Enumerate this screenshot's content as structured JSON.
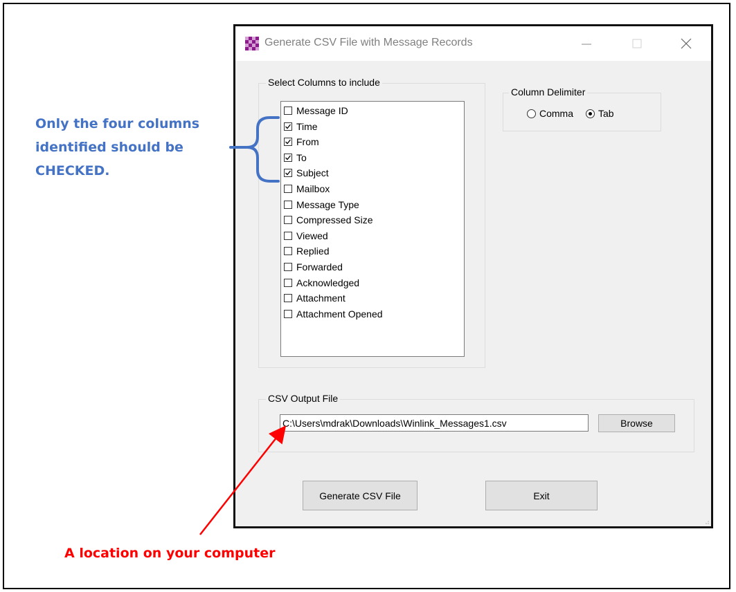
{
  "window": {
    "title": "Generate CSV File with Message Records"
  },
  "columns_group": {
    "label": "Select Columns to include",
    "items": [
      {
        "label": "Message ID",
        "checked": false
      },
      {
        "label": "Time",
        "checked": true
      },
      {
        "label": "From",
        "checked": true
      },
      {
        "label": "To",
        "checked": true
      },
      {
        "label": "Subject",
        "checked": true
      },
      {
        "label": "Mailbox",
        "checked": false
      },
      {
        "label": "Message Type",
        "checked": false
      },
      {
        "label": "Compressed Size",
        "checked": false
      },
      {
        "label": "Viewed",
        "checked": false
      },
      {
        "label": "Replied",
        "checked": false
      },
      {
        "label": "Forwarded",
        "checked": false
      },
      {
        "label": "Acknowledged",
        "checked": false
      },
      {
        "label": "Attachment",
        "checked": false
      },
      {
        "label": "Attachment Opened",
        "checked": false
      }
    ]
  },
  "delimiter_group": {
    "label": "Column Delimiter",
    "options": [
      {
        "label": "Comma",
        "selected": false
      },
      {
        "label": "Tab",
        "selected": true
      }
    ]
  },
  "output_group": {
    "label": "CSV Output File",
    "path_value": "C:\\Users\\mdrak\\Downloads\\Winlink_Messages1.csv",
    "browse_label": "Browse"
  },
  "buttons": {
    "generate_label": "Generate CSV File",
    "exit_label": "Exit"
  },
  "annotations": {
    "blue_lines": [
      "Only the four columns",
      "identified should be",
      "CHECKED."
    ],
    "blue_color": "#4472c4",
    "red_text": "A location on your computer",
    "red_color": "#ff0000"
  },
  "icons": {
    "app": "checkerboard-app-icon",
    "minimize": "minimize-icon",
    "maximize": "maximize-icon",
    "close": "close-icon"
  }
}
